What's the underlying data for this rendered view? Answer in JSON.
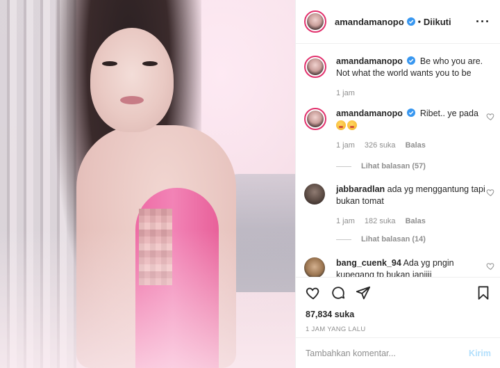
{
  "post": {
    "image_alt": "",
    "author": "amandamanopo",
    "follow_status": "Diikuti"
  },
  "caption": {
    "username": "amandamanopo",
    "text": "Be who you are. Not what the world wants you to be",
    "time": "1 jam"
  },
  "comments": [
    {
      "username": "amandamanopo",
      "text": "Ribet.. ye pada",
      "time": "1 jam",
      "likes": "326 suka",
      "reply_label": "Balas",
      "view_replies": "Lihat balasan (57)"
    },
    {
      "username": "jabbaradlan",
      "text": "ada yg menggantung tapi bukan tomat",
      "time": "1 jam",
      "likes": "182 suka",
      "reply_label": "Balas",
      "view_replies": "Lihat balasan (14)"
    },
    {
      "username": "bang_cuenk_94",
      "text": "Ada yg pngin kupegang tp bukan janjiii"
    }
  ],
  "actions": {
    "likes_count": "87,834 suka",
    "timestamp": "1 JAM YANG LALU"
  },
  "composer": {
    "placeholder": "Tambahkan komentar...",
    "submit_label": "Kirim"
  },
  "colors": {
    "story_ring": "#e1306c",
    "verified": "#3897f0",
    "send_disabled": "#b2dffc",
    "muted_text": "#8e8e8e"
  },
  "icons": {
    "header_more": "more-horizontal-icon",
    "verified": "verified-badge-icon",
    "like": "heart-icon",
    "comment": "comment-bubble-icon",
    "share": "paper-plane-icon",
    "save": "bookmark-icon"
  }
}
